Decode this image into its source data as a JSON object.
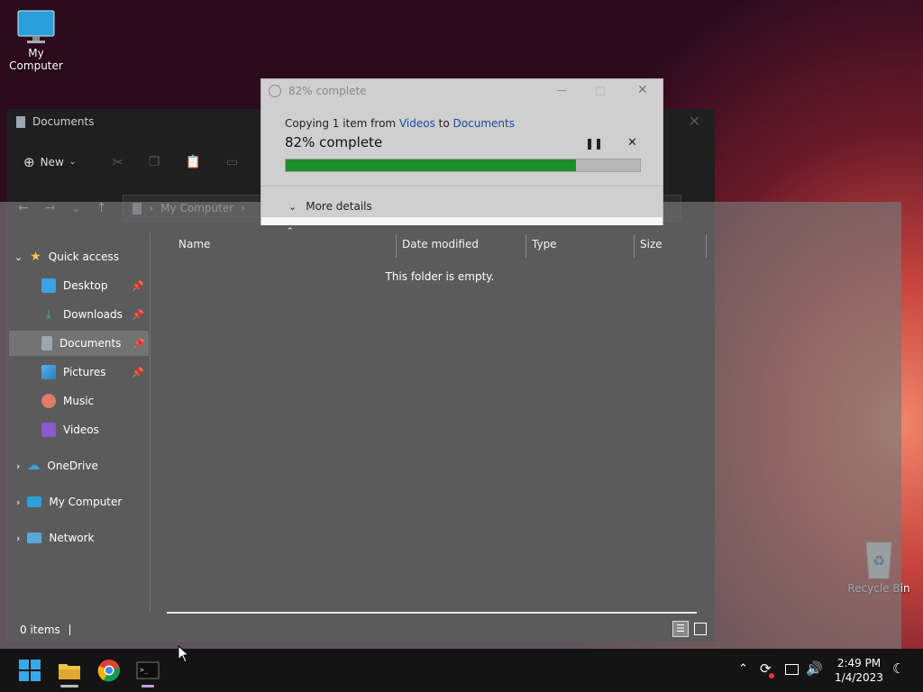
{
  "desktop": {
    "icons": [
      {
        "label": "My Computer"
      },
      {
        "label": "Recycle Bin"
      }
    ]
  },
  "explorer": {
    "title": "Documents",
    "toolbar": {
      "new_label": "New"
    },
    "address": {
      "path": [
        "My Computer"
      ]
    },
    "sidebar": {
      "quick_access": "Quick access",
      "items": [
        {
          "label": "Desktop",
          "pinned": true
        },
        {
          "label": "Downloads",
          "pinned": true
        },
        {
          "label": "Documents",
          "pinned": true,
          "selected": true
        },
        {
          "label": "Pictures",
          "pinned": true
        },
        {
          "label": "Music",
          "pinned": false
        },
        {
          "label": "Videos",
          "pinned": false
        }
      ],
      "onedrive": "OneDrive",
      "my_computer": "My Computer",
      "network": "Network"
    },
    "columns": [
      "Name",
      "Date modified",
      "Type",
      "Size"
    ],
    "empty_message": "This folder is empty.",
    "status": "0 items"
  },
  "copy_dialog": {
    "title": "82% complete",
    "copying_prefix": "Copying 1 item from",
    "source": "Videos",
    "connector": "to",
    "destination": "Documents",
    "progress_text": "82% complete",
    "progress": 0.82,
    "more_details": "More details",
    "colors": {
      "fill": "#1e8e28",
      "track": "#b8b8b8"
    }
  },
  "taskbar": {
    "time": "2:49 PM",
    "date": "1/4/2023"
  }
}
